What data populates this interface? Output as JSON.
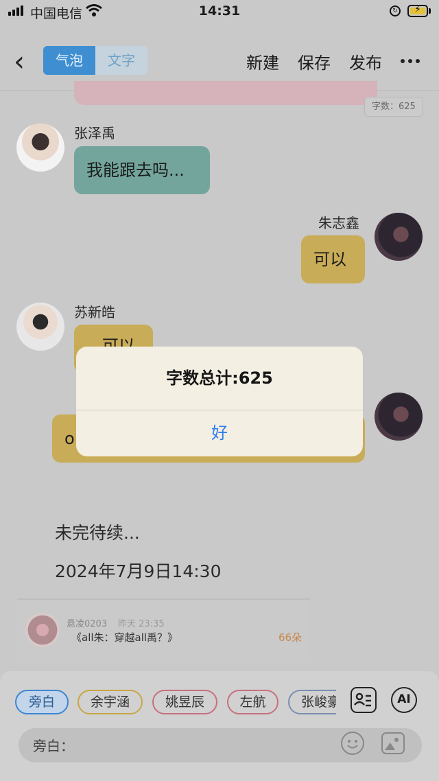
{
  "status_bar": {
    "carrier": "中国电信",
    "time": "14:31"
  },
  "nav": {
    "tabs": [
      "气泡",
      "文字"
    ],
    "new_label": "新建",
    "save_label": "保存",
    "publish_label": "发布"
  },
  "word_count_chip": "字数：625",
  "messages": [
    {
      "name": "张泽禹",
      "text": "我能跟去吗..."
    },
    {
      "name": "朱志鑫",
      "text": "可以"
    },
    {
      "name": "苏新皓",
      "text": "...可以"
    },
    {
      "name": "",
      "text": "o"
    }
  ],
  "narration": [
    "未完待续...",
    "2024年7月9日14:30"
  ],
  "card": {
    "author": "悬凌0203",
    "time": "昨天 23:35",
    "title": "《all朱：穿越all禹？》",
    "flowers": "66朵"
  },
  "chips": [
    "旁白",
    "余宇涵",
    "姚昱辰",
    "左航",
    "张峻豪"
  ],
  "chip_colors": [
    "#3e86d3",
    "#c8a646",
    "#c8707d",
    "#c8707d",
    "#7a8fb0"
  ],
  "ai_label": "AI",
  "input_label": "旁白：",
  "alert": {
    "message": "字数总计:625",
    "ok_label": "好"
  }
}
